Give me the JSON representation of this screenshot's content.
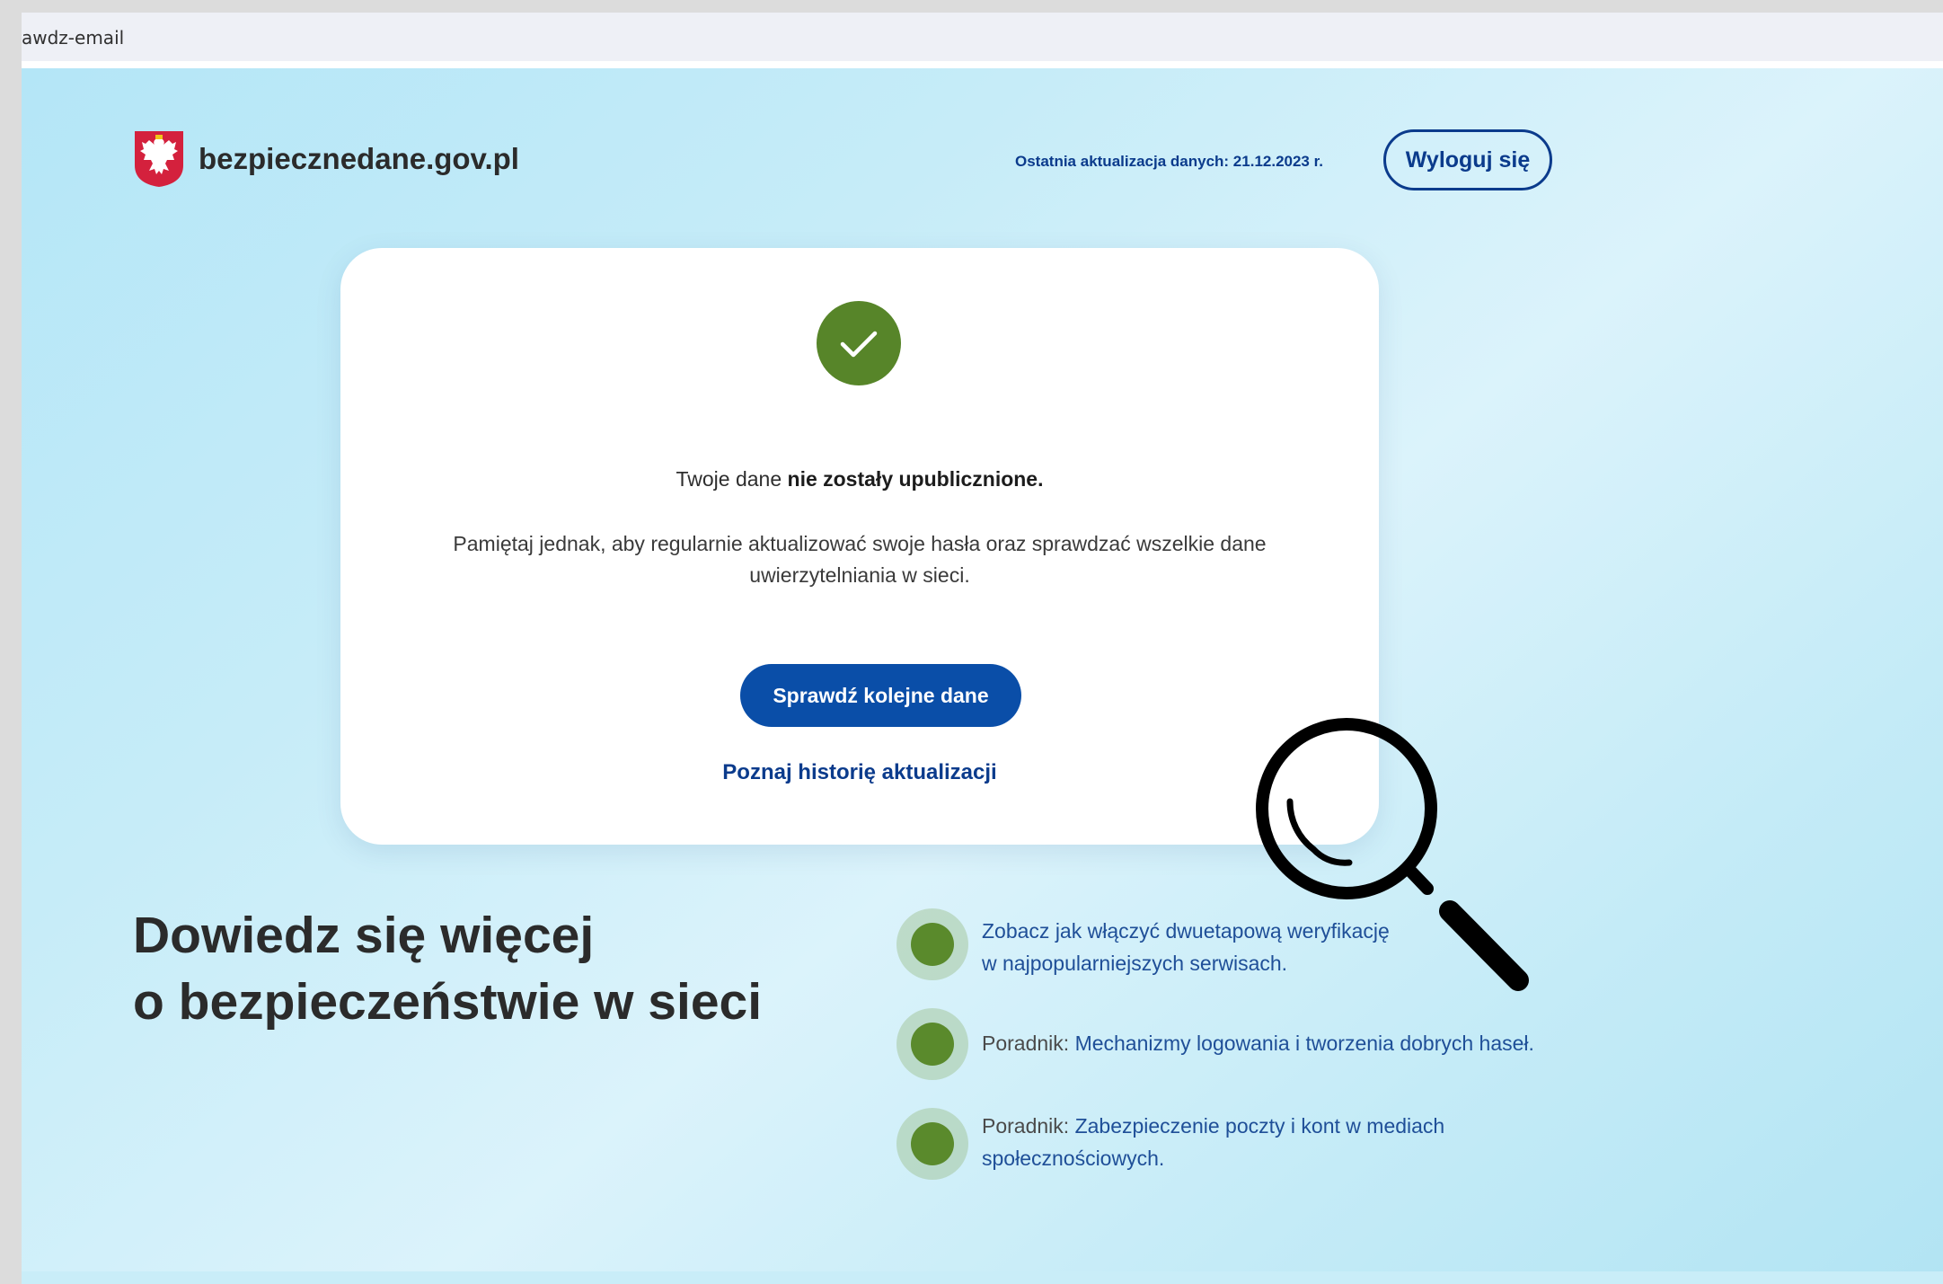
{
  "browser": {
    "address_text": "awdz-email"
  },
  "header": {
    "site_name": "bezpiecznedane.gov.pl",
    "update_info": "Ostatnia aktualizacja danych: 21.12.2023 r.",
    "logout_label": "Wyloguj się"
  },
  "result_card": {
    "status_prefix": "Twoje dane ",
    "status_bold": "nie zostały upublicznione.",
    "advice_text": "Pamiętaj jednak, aby regularnie aktualizować swoje hasła oraz sprawdzać wszelkie dane uwierzytelniania w sieci.",
    "primary_button_label": "Sprawdź kolejne dane",
    "history_link_label": "Poznaj historię aktualizacji"
  },
  "learn_more": {
    "headline_line1": "Dowiedz się więcej",
    "headline_line2": "o bezpieczeństwie w sieci",
    "items": [
      {
        "prefix": "",
        "link_line1": "Zobacz jak włączyć dwuetapową weryfikację",
        "link_line2": "w najpopularniejszych serwisach."
      },
      {
        "prefix": "Poradnik: ",
        "link_line1": "Mechanizmy logowania i tworzenia dobrych haseł.",
        "link_line2": ""
      },
      {
        "prefix": "Poradnik: ",
        "link_line1": "Zabezpieczenie poczty i kont w mediach",
        "link_line2": "społecznościowych."
      }
    ]
  },
  "colors": {
    "brand_navy": "#0b3b8c",
    "primary_button": "#0a4ea8",
    "success_green": "#578529",
    "bullet_green": "#5a8a2c"
  },
  "icons": {
    "logo": "polish-eagle-emblem-icon",
    "status": "check-icon",
    "overlay": "magnifier-icon"
  }
}
